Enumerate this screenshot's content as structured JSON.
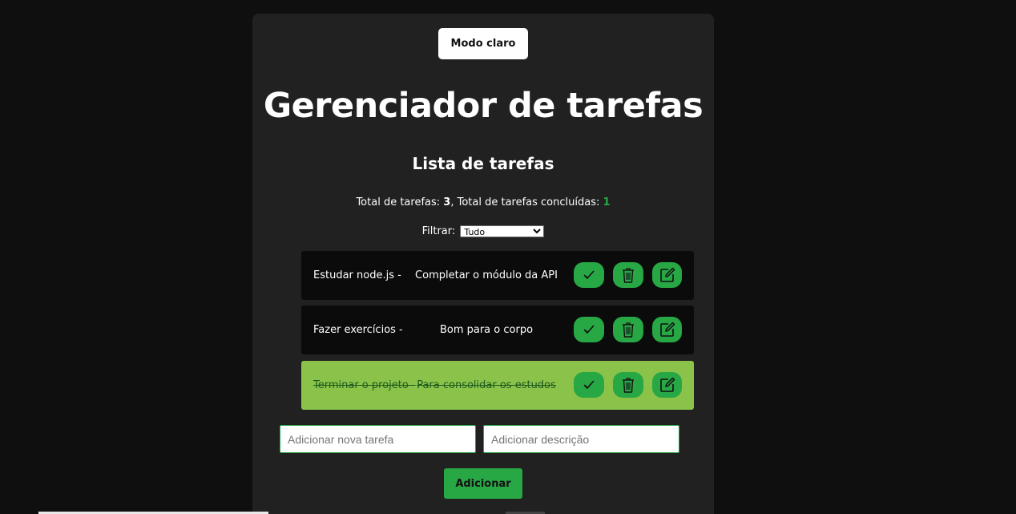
{
  "header": {
    "mode_button": "Modo claro",
    "title": "Gerenciador de tarefas",
    "subtitle": "Lista de tarefas"
  },
  "totals": {
    "label_total": "Total de tarefas: ",
    "total": "3",
    "label_done": ", Total de tarefas concluídas: ",
    "done": "1"
  },
  "filter": {
    "label": "Filtrar:",
    "selected": "Tudo"
  },
  "tasks": [
    {
      "name": "Estudar node.js -",
      "description": "Completar o módulo da API",
      "completed": false
    },
    {
      "name": "Fazer exercícios -",
      "description": "Bom para o corpo",
      "completed": false
    },
    {
      "name": "Terminar o projeto -",
      "description": "Para consolidar os estudos",
      "completed": true
    }
  ],
  "form": {
    "task_placeholder": "Adicionar nova tarefa",
    "desc_placeholder": "Adicionar descrição",
    "add_button": "Adicionar"
  },
  "icons": {
    "complete": "check-icon",
    "delete": "trash-icon",
    "edit": "edit-icon"
  },
  "colors": {
    "accent": "#28a745",
    "completed_row": "#8bc34a",
    "panel": "#212121",
    "background": "#0f0f0f",
    "task_row": "#0b0b0b"
  }
}
